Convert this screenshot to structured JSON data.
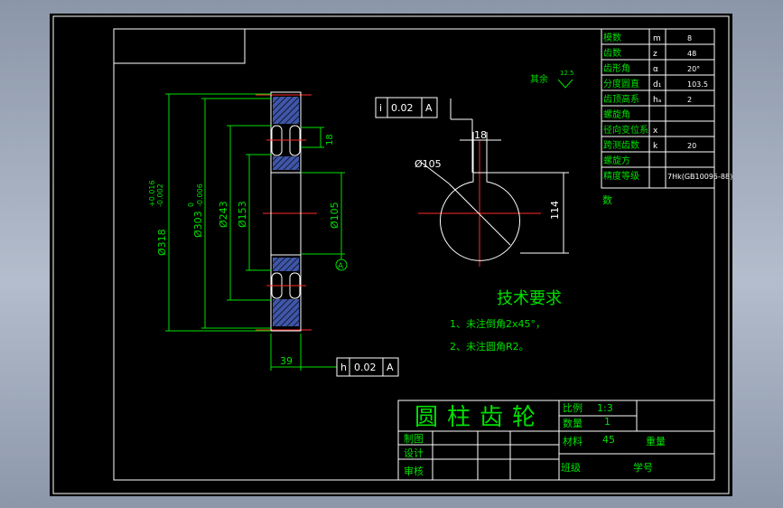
{
  "title_block": {
    "part_name": "圆柱齿轮",
    "scale_label": "比例",
    "scale_value": "1:3",
    "qty_label": "数量",
    "qty_value": "1",
    "material_label": "材料",
    "material_value": "45",
    "weight_label": "重量",
    "drawn_label": "制图",
    "design_label": "设计",
    "review_label": "审核",
    "class_label": "班级",
    "student_no_label": "学号"
  },
  "param_table": [
    {
      "name": "模数",
      "symbol": "m",
      "value": "8"
    },
    {
      "name": "齿数",
      "symbol": "z",
      "value": "48"
    },
    {
      "name": "齿形角",
      "symbol": "α",
      "value": "20°"
    },
    {
      "name": "分度圆直",
      "symbol": "d₁",
      "value": "103.5"
    },
    {
      "name": "齿顶高系",
      "symbol": "hₐ",
      "value": "2"
    },
    {
      "name": "螺旋角",
      "symbol": "",
      "value": ""
    },
    {
      "name": "径向变位系",
      "symbol": "x",
      "value": ""
    },
    {
      "name": "跨测齿数",
      "symbol": "k",
      "value": "20"
    },
    {
      "name": "螺旋方",
      "symbol": "",
      "value": ""
    },
    {
      "name": "精度等级",
      "symbol": "",
      "value": "7Hk(GB10095-88)"
    }
  ],
  "param_overflow": "数",
  "dims": {
    "d1": "Ø318",
    "d1_tol_up": "+0.016",
    "d1_tol_low": "-0.002",
    "d2": "Ø303",
    "d2_tol_up": "0",
    "d2_tol_low": "-0.006",
    "d3": "Ø243",
    "d4": "Ø153",
    "d5": "Ø105",
    "width": "39",
    "key_width": "18",
    "bore": "Ø105",
    "key_depth": "114"
  },
  "tolerances": {
    "runout_symbol": "i",
    "runout_value": "0.02",
    "runout_datum": "A",
    "face_symbol": "h",
    "face_value": "0.02",
    "face_datum": "A",
    "datum_label": "A"
  },
  "surface": {
    "label": "其余",
    "value": "12.5"
  },
  "tech_req": {
    "title": "技术要求",
    "items": [
      "1、未注倒角2x45°，",
      "2、未注圆角R2。"
    ]
  }
}
